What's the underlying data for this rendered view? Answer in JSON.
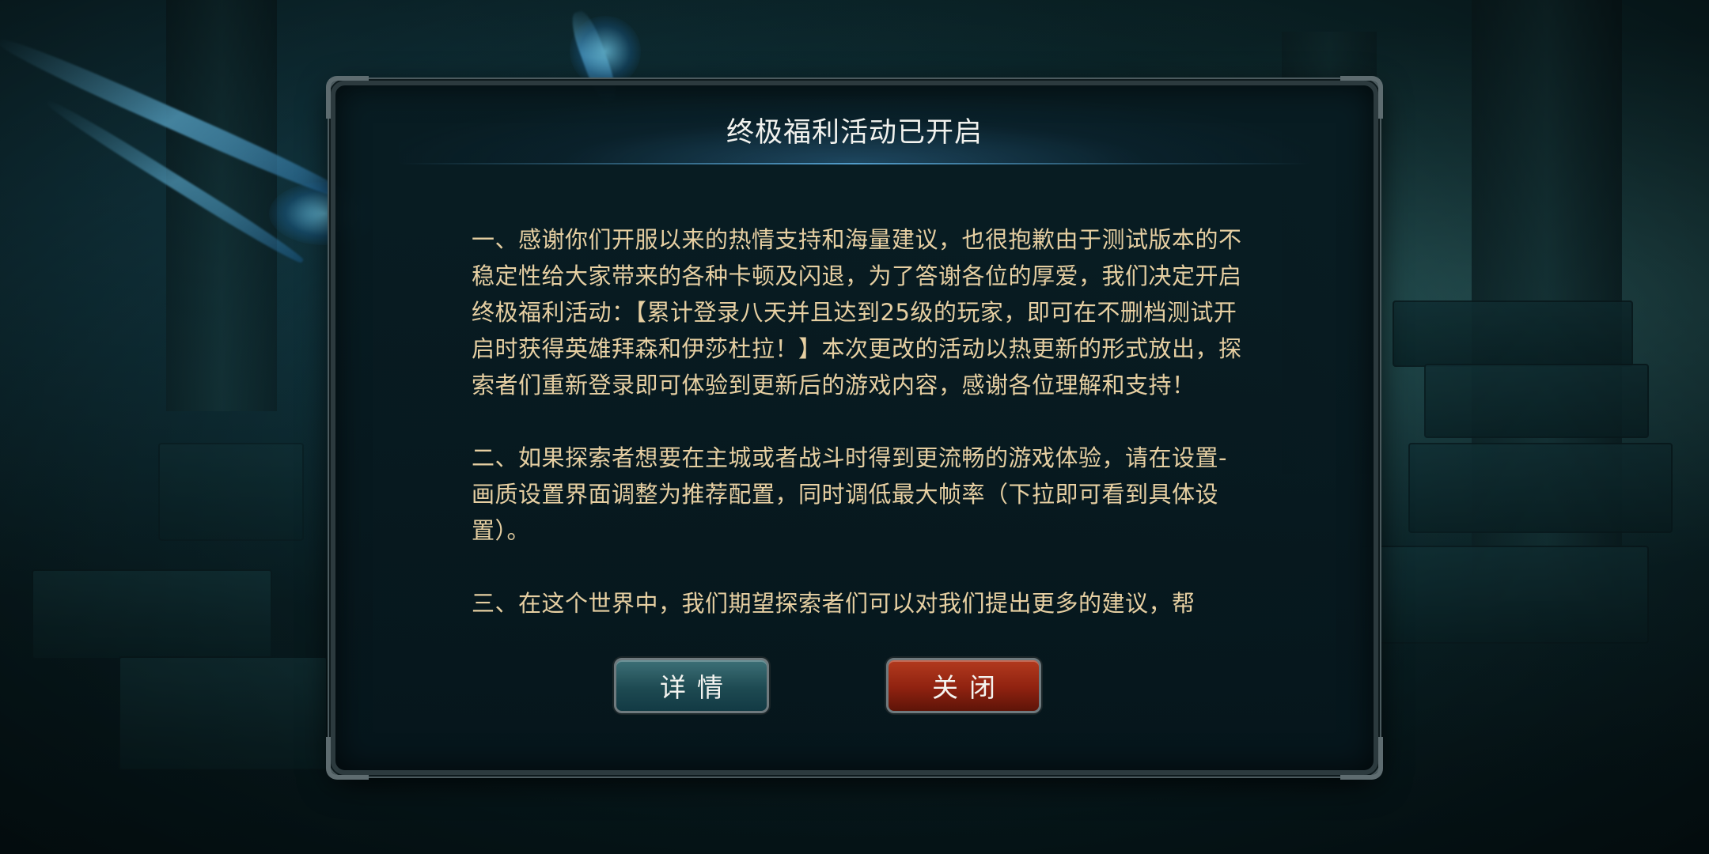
{
  "dialog": {
    "title": "终极福利活动已开启",
    "paragraphs": [
      "一、感谢你们开服以来的热情支持和海量建议，也很抱歉由于测试版本的不稳定性给大家带来的各种卡顿及闪退，为了答谢各位的厚爱，我们决定开启终极福利活动：【累计登录八天并且达到25级的玩家，即可在不删档测试开启时获得英雄拜森和伊莎杜拉！】本次更改的活动以热更新的形式放出，探索者们重新登录即可体验到更新后的游戏内容，感谢各位理解和支持！",
      "二、如果探索者想要在主城或者战斗时得到更流畅的游戏体验，请在设置-画质设置界面调整为推荐配置，同时调低最大帧率（下拉即可看到具体设置）。",
      "三、在这个世界中，我们期望探索者们可以对我们提出更多的建议，帮"
    ],
    "buttons": {
      "details": "详情",
      "close": "关闭"
    }
  },
  "colors": {
    "body_text": "#e6cfa2",
    "title_text": "#f2f2ee",
    "close_button": "#8f2210",
    "details_button": "#1e4a52"
  }
}
